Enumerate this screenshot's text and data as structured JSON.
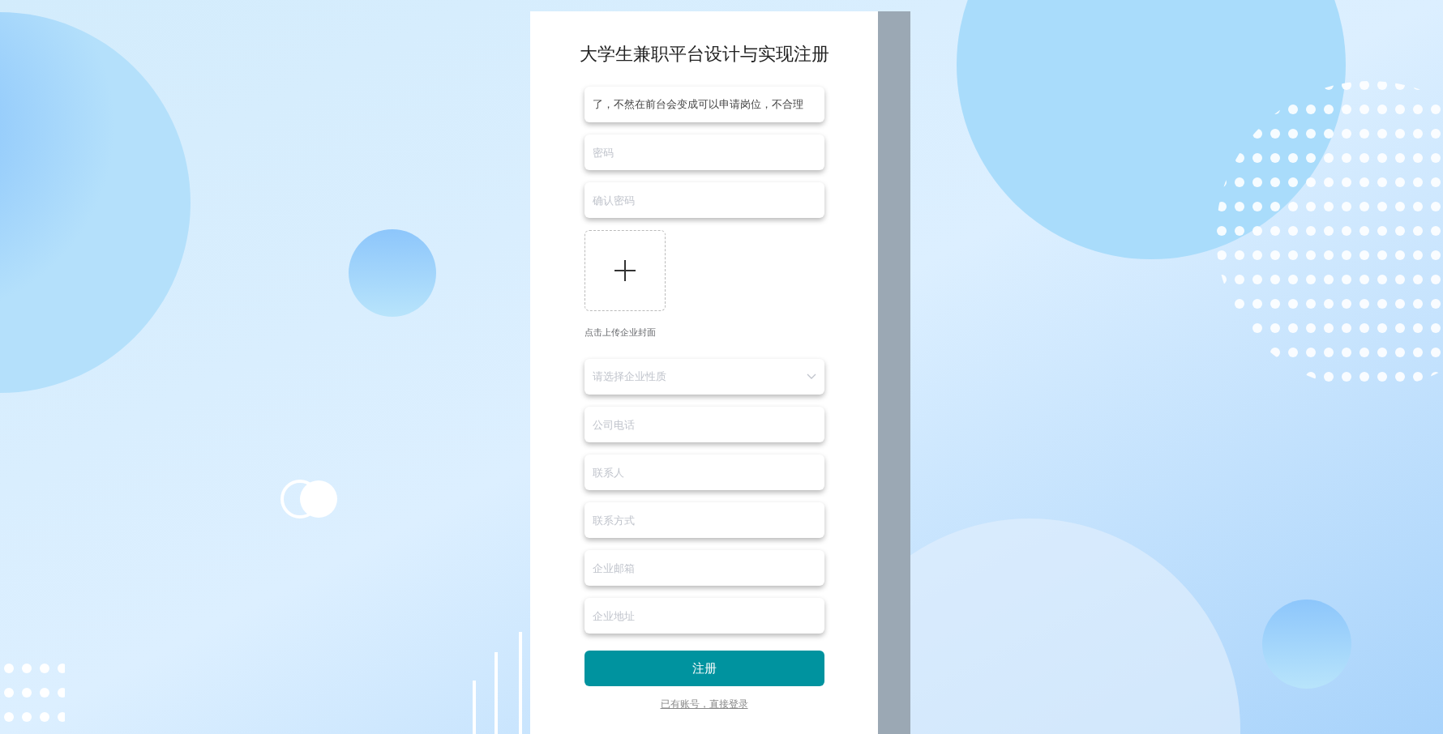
{
  "title": "大学生兼职平台设计与实现注册",
  "fields": [
    {
      "kind": "input",
      "value": "了，不然在前台会变成可以申请岗位，不合理"
    },
    {
      "kind": "input",
      "placeholder": "密码"
    },
    {
      "kind": "input",
      "placeholder": "确认密码"
    },
    {
      "kind": "upload",
      "hint": "点击上传企业封面"
    },
    {
      "kind": "select",
      "placeholder": "请选择企业性质"
    },
    {
      "kind": "input",
      "placeholder": "公司电话"
    },
    {
      "kind": "input",
      "placeholder": "联系人"
    },
    {
      "kind": "input",
      "placeholder": "联系方式"
    },
    {
      "kind": "input",
      "placeholder": "企业邮箱"
    },
    {
      "kind": "input",
      "placeholder": "企业地址"
    }
  ],
  "submit_button": "注册",
  "login_link": "已有账号，直接登录"
}
